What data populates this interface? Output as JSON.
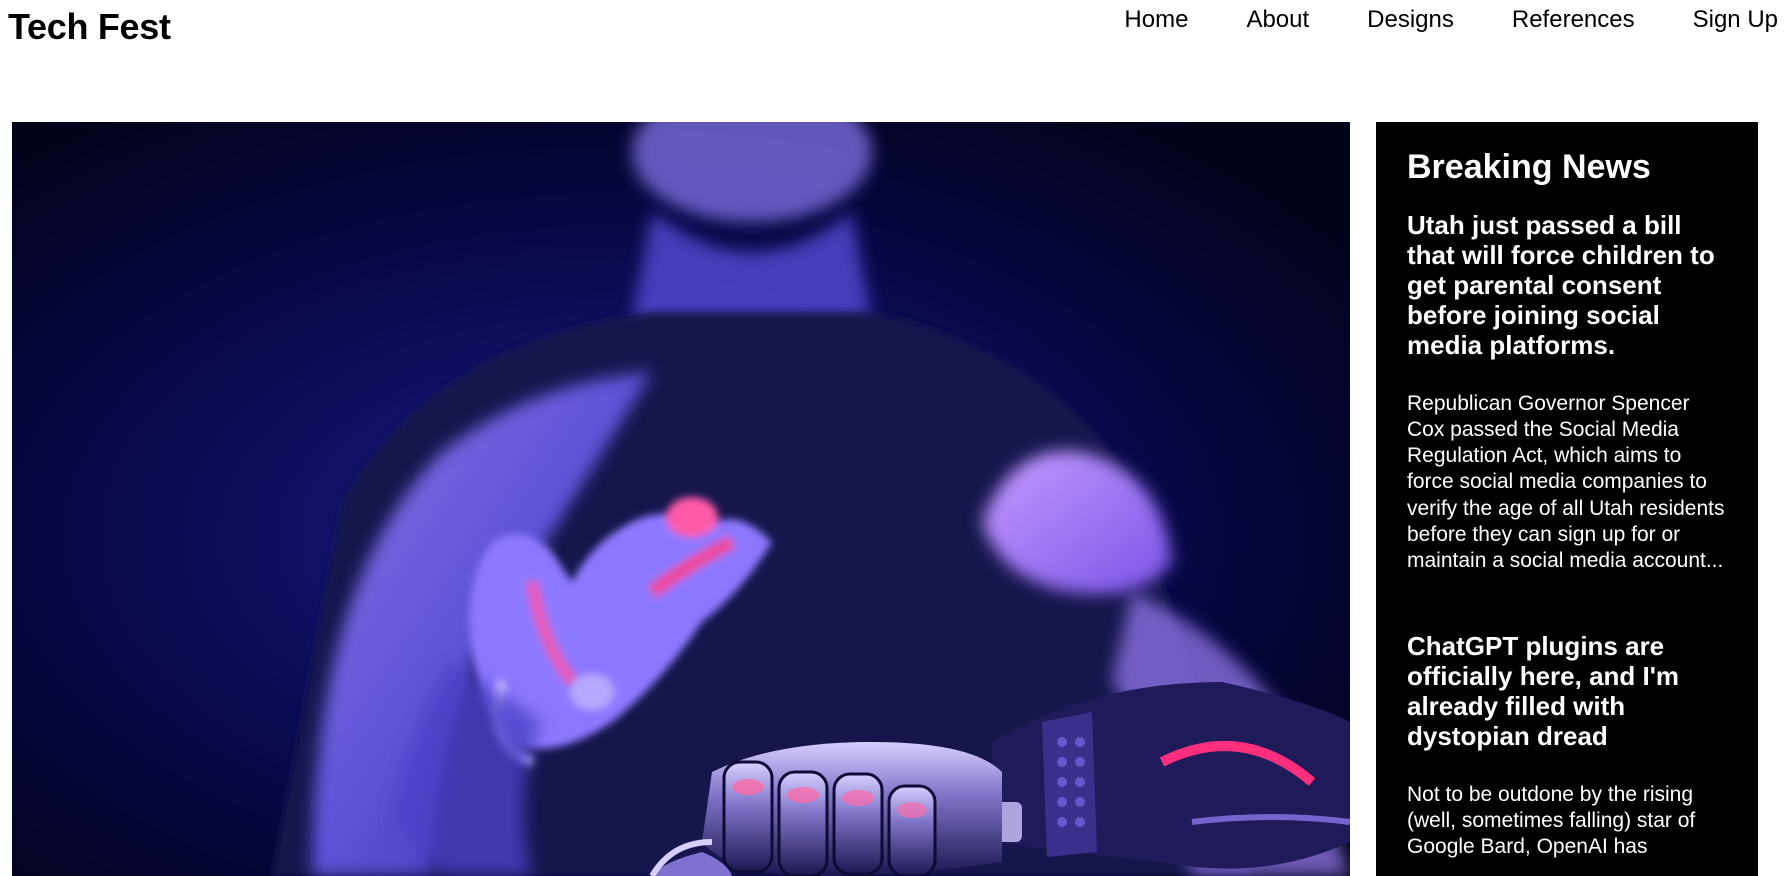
{
  "header": {
    "logo": "Tech Fest",
    "nav": [
      "Home",
      "About",
      "Designs",
      "References",
      "Sign Up"
    ]
  },
  "hero": {
    "image_description_icon": "hero-image"
  },
  "breaking_news": {
    "title": "Breaking News",
    "articles": [
      {
        "headline": "Utah just passed a bill that will force children to get parental consent before joining social media platforms.",
        "body": "Republican Governor Spencer Cox passed the Social Media Regulation Act, which aims to force social media companies to verify the age of all Utah residents before they can sign up for or maintain a social media account..."
      },
      {
        "headline": "ChatGPT plugins are officially here, and I'm already filled with dystopian dread",
        "body": "Not to be outdone by the rising (well, sometimes falling) star of Google Bard, OpenAI has"
      }
    ]
  },
  "colors": {
    "news_bg": "#000000",
    "hero_bg": "#030320",
    "accent_purple": "#8a6cff",
    "accent_pink": "#e0307a"
  }
}
